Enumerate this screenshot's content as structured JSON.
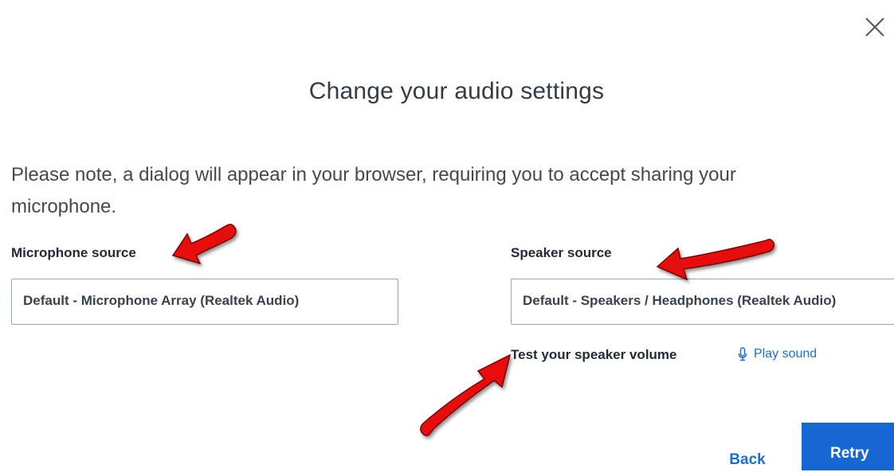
{
  "dialog": {
    "title": "Change your audio settings",
    "note": "Please note, a dialog will appear in your browser, requiring you to accept sharing your microphone."
  },
  "microphone": {
    "label": "Microphone source",
    "selected": "Default - Microphone Array (Realtek Audio)"
  },
  "speaker": {
    "label": "Speaker source",
    "selected": "Default - Speakers / Headphones (Realtek Audio)",
    "test_label": "Test your speaker volume",
    "play_label": "Play sound"
  },
  "buttons": {
    "back": "Back",
    "retry": "Retry"
  },
  "icons": {
    "close": "close-icon",
    "play": "microphone-icon",
    "annotation": "red-arrow"
  },
  "colors": {
    "accent": "#1667d2",
    "link": "#1a6fd1",
    "annotation_arrow": "#e8110f"
  }
}
